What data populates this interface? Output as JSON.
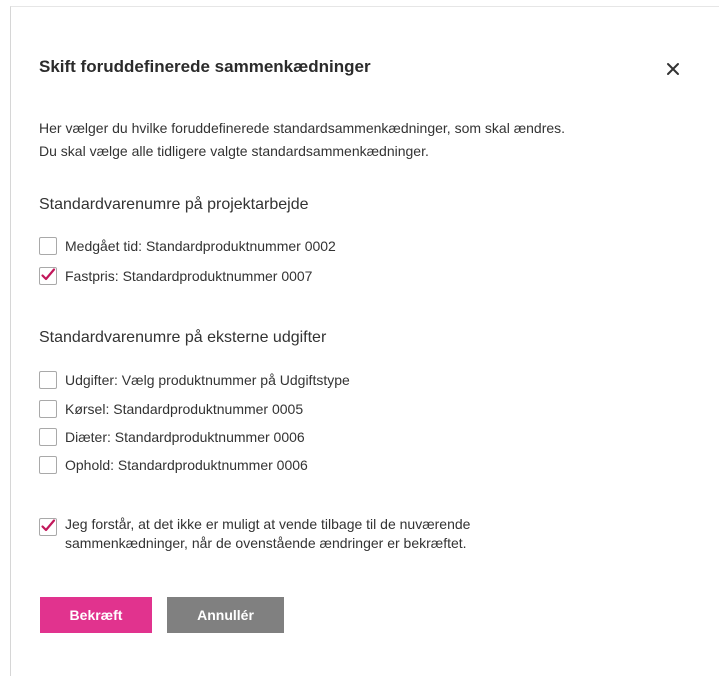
{
  "dialog": {
    "title": "Skift foruddefinerede sammenkædninger",
    "close_icon": "close-icon",
    "description_line1": "Her vælger du hvilke foruddefinerede standardsammenkædninger, som skal ændres.",
    "description_line2": "Du skal vælge alle tidligere valgte standardsammenkædninger."
  },
  "sections": [
    {
      "title": "Standardvarenumre på projektarbejde",
      "options": [
        {
          "label": "Medgået tid: Standardproduktnummer 0002",
          "checked": false
        },
        {
          "label": "Fastpris: Standardproduktnummer 0007",
          "checked": true
        }
      ]
    },
    {
      "title": "Standardvarenumre på eksterne udgifter",
      "options": [
        {
          "label": "Udgifter: Vælg produktnummer på Udgiftstype",
          "checked": false
        },
        {
          "label": "Kørsel: Standardproduktnummer 0005",
          "checked": false
        },
        {
          "label": "Diæter: Standardproduktnummer 0006",
          "checked": false
        },
        {
          "label": "Ophold: Standardproduktnummer 0006",
          "checked": false
        }
      ]
    }
  ],
  "confirmation": {
    "line1": "Jeg forstår, at det ikke er muligt at vende tilbage til de nuværende",
    "line2": "sammenkædninger, når de ovenstående ændringer er bekræftet.",
    "checked": true
  },
  "buttons": {
    "confirm_label": "Bekræft",
    "cancel_label": "Annullér"
  },
  "colors": {
    "accent": "#e1338e",
    "cancel": "#808080",
    "checkmark": "#c2185b"
  }
}
